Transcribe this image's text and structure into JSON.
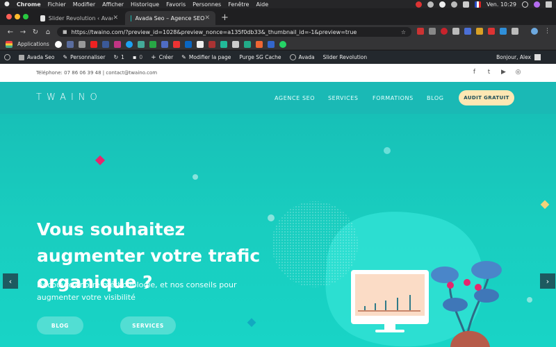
{
  "menubar": {
    "apple": "",
    "app": "Chrome",
    "items": [
      "Fichier",
      "Modifier",
      "Afficher",
      "Historique",
      "Favoris",
      "Personnes",
      "Fenêtre",
      "Aide"
    ],
    "clock": "Ven. 10:29"
  },
  "tabs": [
    {
      "title": "Slider Revolution ‹ Avada Seo ‹",
      "close": "✕"
    },
    {
      "title": "Avada Seo – Agence SEO",
      "close": "✕"
    }
  ],
  "newtab": "+",
  "address": {
    "url": "https://twaino.com/?preview_id=1028&preview_nonce=a135f0db33&_thumbnail_id=-1&preview=true",
    "star": "☆"
  },
  "nav": {
    "back": "←",
    "forward": "→",
    "reload": "↻",
    "home": "⌂"
  },
  "bookmarks": {
    "apps_label": "Applications"
  },
  "wpbar": {
    "site": "Avada Seo",
    "customize": "Personnaliser",
    "updates": "1",
    "comments": "0",
    "create": "Créer",
    "edit": "Modifier la page",
    "purge": "Purge SG Cache",
    "avada": "Avada",
    "slider": "Slider Revolution",
    "greeting": "Bonjour, Alex"
  },
  "site": {
    "contact": "Téléphone: 07 86 06 39 48  |  contact@twaino.com",
    "logo": "TWAINO",
    "nav": [
      "AGENCE SEO",
      "SERVICES",
      "FORMATIONS",
      "BLOG"
    ],
    "cta": "AUDIT GRATUIT",
    "social": {
      "facebook": "f",
      "twitter": "t",
      "youtube": "▶",
      "instagram": "◎"
    }
  },
  "hero": {
    "title": "Vous souhaitez augmenter votre trafic organique ?",
    "subtitle": "Découvrez notre méthodologie, et nos conseils pour augmenter votre visibilité",
    "buttons": [
      "BLOG",
      "SERVICES"
    ],
    "prev": "‹",
    "next": "›"
  },
  "colors": {
    "teal_header": "#1ab9b5",
    "cta_bg": "#fde7b3",
    "wp_bar": "#23282d"
  }
}
